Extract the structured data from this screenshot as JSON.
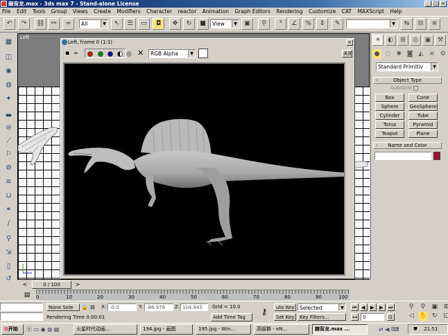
{
  "app": {
    "title": "棘背龙.max - 3ds max 7 - Stand-alone License",
    "window_buttons": [
      "_",
      "□",
      "×"
    ]
  },
  "menu": [
    "File",
    "Edit",
    "Tools",
    "Group",
    "Views",
    "Create",
    "Modifiers",
    "Character",
    "reactor",
    "Animation",
    "Graph Editors",
    "Rendering",
    "Customize",
    "CAT",
    "MAXScript",
    "Help"
  ],
  "toolbar": {
    "selection_filter": "All",
    "reference_coord": "View"
  },
  "viewport": {
    "label": "Left"
  },
  "frame_window": {
    "title": "Left, frame 0 (1:1)",
    "channel_select": "RGB Alpha",
    "close_label": "关闭"
  },
  "command_panel": {
    "category": "Standard Primitiv",
    "object_type_title": "Object Type",
    "autogrid_label": "AutoGrid",
    "buttons": [
      "Box",
      "Cone",
      "Sphere",
      "GeoSphere",
      "Cylinder",
      "Tube",
      "Torus",
      "Pyramid",
      "Teapot",
      "Plane"
    ],
    "name_color_title": "Name and Color",
    "color_swatch": "#9b1035"
  },
  "timeline": {
    "frame_indicator": "0 / 100",
    "ruler_labels": [
      "0",
      "10",
      "20",
      "30",
      "40",
      "50",
      "60",
      "70",
      "80",
      "90",
      "100"
    ]
  },
  "status": {
    "selection": "None Sele",
    "x_label": "X:",
    "x_value": "-0.0",
    "y_label": "Y:",
    "y_value": "-86.978",
    "z_label": "Z:",
    "z_value": "104.945",
    "grid": "Grid = 10.0",
    "render_time": "Rendering Time  0:00:01",
    "add_time_tag": "Add Time Tag",
    "auto_key": "uto Key",
    "key_mode": "Selected",
    "set_key": "Set Key",
    "key_filters": "Key Filters...",
    "frame_field": "0"
  },
  "taskbar": {
    "start": "开始",
    "tasks": [
      "火星时代动画...",
      "194.jpg - 画图",
      "195.jpg - Win...",
      "高级群 - eN...",
      "棘背龙.max ..."
    ],
    "clock": "21:51"
  }
}
